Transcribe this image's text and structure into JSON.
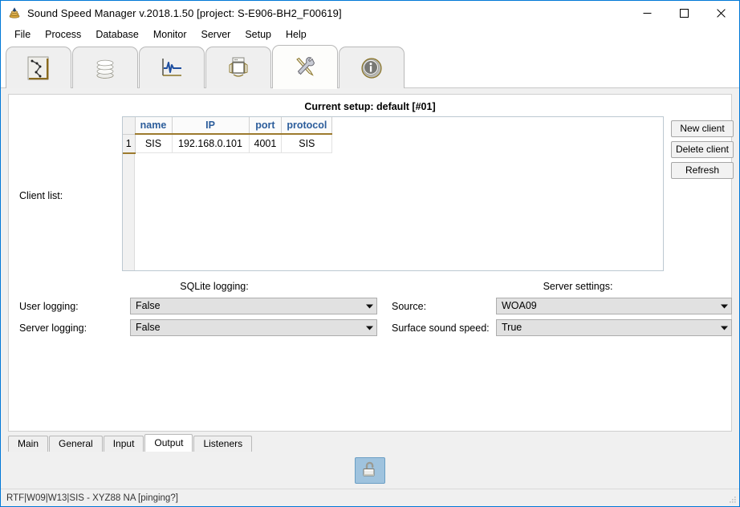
{
  "window": {
    "title": "Sound Speed Manager v.2018.1.50 [project: S-E906-BH2_F00619]",
    "app_icon": "stack-icon",
    "accent_color": "#0078d7",
    "controls": [
      {
        "name": "minimize-button",
        "glyph": "minimize-icon"
      },
      {
        "name": "maximize-button",
        "glyph": "maximize-icon"
      },
      {
        "name": "close-button",
        "glyph": "close-icon"
      }
    ]
  },
  "menu": {
    "items": [
      {
        "label": "File"
      },
      {
        "label": "Process"
      },
      {
        "label": "Database"
      },
      {
        "label": "Monitor"
      },
      {
        "label": "Server"
      },
      {
        "label": "Setup"
      },
      {
        "label": "Help"
      }
    ]
  },
  "icon_tabs": {
    "selected_index": 4,
    "items": [
      {
        "icon": "sound-speed-profile-icon",
        "name": "tab-editor"
      },
      {
        "icon": "database-icon",
        "name": "tab-database"
      },
      {
        "icon": "waveform-chart-icon",
        "name": "tab-monitor"
      },
      {
        "icon": "server-rack-icon",
        "name": "tab-server"
      },
      {
        "icon": "tools-icon",
        "name": "tab-setup"
      },
      {
        "icon": "info-icon",
        "name": "tab-info"
      }
    ]
  },
  "main": {
    "setup_header": "Current setup: default [#01]",
    "client_list_label": "Client list:",
    "table": {
      "columns": [
        "name",
        "IP",
        "port",
        "protocol"
      ],
      "rows": [
        {
          "index": "1",
          "name": "SIS",
          "ip": "192.168.0.101",
          "port": "4001",
          "protocol": "SIS"
        }
      ]
    },
    "buttons": [
      {
        "label": "New client",
        "name": "new-client-button"
      },
      {
        "label": "Delete client",
        "name": "delete-client-button"
      },
      {
        "label": "Refresh",
        "name": "refresh-button"
      }
    ],
    "sqlite_logging": {
      "title": "SQLite logging:",
      "fields": [
        {
          "label": "User logging:",
          "value": "False"
        },
        {
          "label": "Server logging:",
          "value": "False"
        }
      ]
    },
    "server_settings": {
      "title": "Server settings:",
      "fields": [
        {
          "label": "Source:",
          "value": "WOA09"
        },
        {
          "label": "Surface sound speed:",
          "value": "True"
        }
      ]
    }
  },
  "bottom_tabs": {
    "selected_index": 3,
    "items": [
      {
        "label": "Main"
      },
      {
        "label": "General"
      },
      {
        "label": "Input"
      },
      {
        "label": "Output"
      },
      {
        "label": "Listeners"
      }
    ]
  },
  "lock_button": {
    "name": "unlock-button",
    "icon": "open-padlock-icon",
    "highlight_color": "#9fc3de"
  },
  "statusbar": {
    "text": "RTF|W09|W13|SIS  -  XYZ88 NA [pinging?]"
  }
}
